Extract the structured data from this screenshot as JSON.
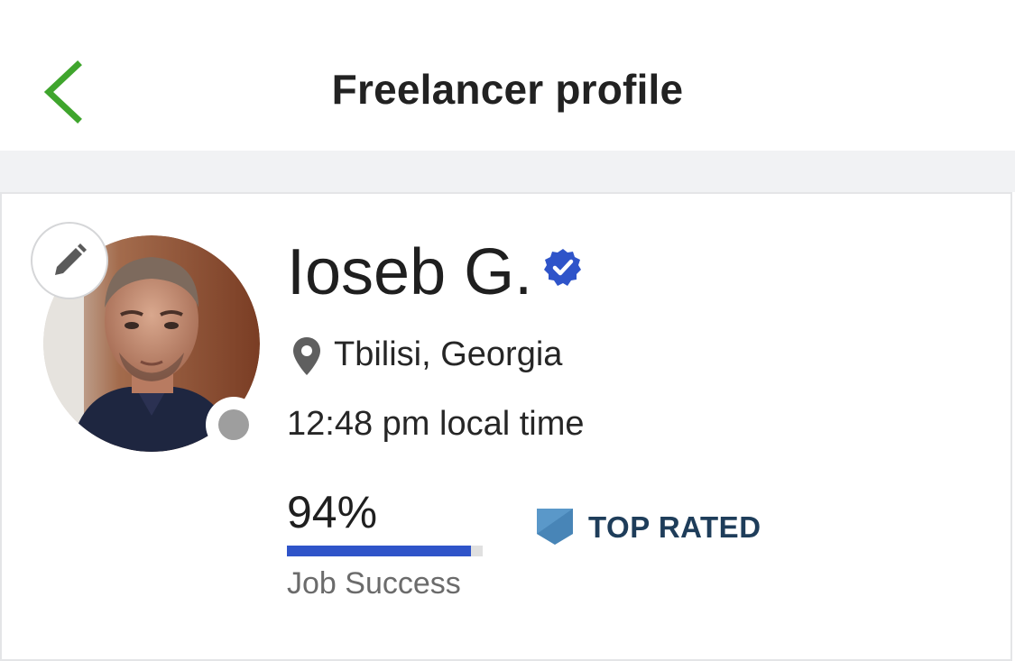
{
  "header": {
    "title": "Freelancer profile",
    "back_icon": "chevron-left-icon",
    "accent_color": "#3fa52d"
  },
  "profile": {
    "name": "Ioseb G.",
    "verified": true,
    "verified_icon": "verified-badge-icon",
    "location": "Tbilisi, Georgia",
    "location_icon": "map-pin-icon",
    "local_time": "12:48 pm local time",
    "online_status": "offline",
    "edit_icon": "pencil-icon"
  },
  "stats": {
    "job_success_value": "94%",
    "job_success_fraction": 0.94,
    "job_success_label": "Job Success",
    "job_success_color": "#2f54c9",
    "badge_label": "TOP RATED",
    "badge_icon": "top-rated-badge-icon",
    "badge_color": "#5a98c9"
  }
}
